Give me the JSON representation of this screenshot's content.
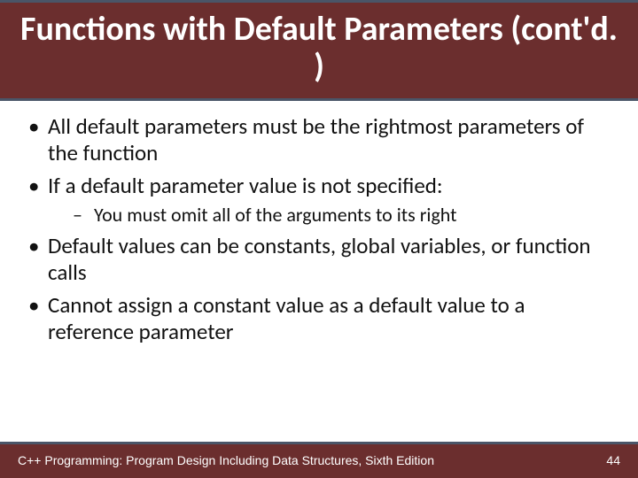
{
  "title": "Functions with Default Parameters (cont'd. )",
  "bullets": [
    {
      "text": "All default parameters must be the rightmost parameters of the function"
    },
    {
      "text": "If a default parameter value is not specified:",
      "sub": [
        {
          "text": "You must omit all of the arguments to its right"
        }
      ]
    },
    {
      "text": "Default values can be constants, global variables, or function calls"
    },
    {
      "text": "Cannot assign a constant value as a default value to a reference parameter"
    }
  ],
  "footer": {
    "source": "C++ Programming: Program Design Including Data Structures, Sixth Edition",
    "page": "44"
  }
}
